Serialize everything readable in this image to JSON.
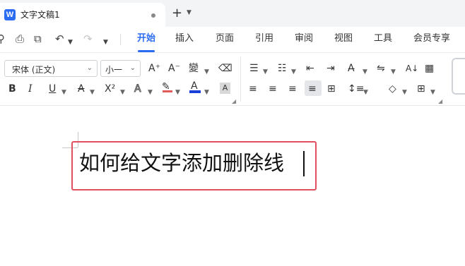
{
  "tabbar": {
    "app_logo": "W",
    "doc_title": "文字文稿1",
    "new_tab": "+",
    "arrow": "⌄"
  },
  "menubar": {
    "quick_access": {
      "save": "⌕",
      "print": "⎙",
      "preview": "⌕",
      "undo": "↶",
      "undo_arrow": "⌄",
      "redo": "↷",
      "more": "⌄"
    },
    "tabs": [
      "开始",
      "插入",
      "页面",
      "引用",
      "审阅",
      "视图",
      "工具",
      "会员专享"
    ],
    "active_tab": "开始"
  },
  "ribbon": {
    "font_name": "宋体 (正文)",
    "font_size": "小一",
    "buttons": {
      "grow_font": "A⁺",
      "shrink_font": "A⁻",
      "phonetic": "變",
      "clear_format": "⌫",
      "bold": "B",
      "italic": "I",
      "underline": "U",
      "strikethrough": "Ꝋ",
      "superscript": "X²",
      "text_effect": "A",
      "highlight": "ℤ",
      "font_color": "A",
      "char_shading": "A",
      "bullets": "⁝≡",
      "numbering": "⒈≡",
      "decrease_indent": "⇤",
      "increase_indent": "⇥",
      "text_direction": "A͡",
      "line_break": "⇋",
      "sort": "A↓",
      "table_border": "▦",
      "align_left": "≡",
      "align_center": "≡",
      "align_right": "≡",
      "justify": "≡",
      "distribute": "⊞",
      "line_spacing": "↕≡",
      "shading": "◇",
      "borders": "⊞",
      "caret": "▾",
      "launcher": "◢"
    }
  },
  "document": {
    "content": "如何给文字添加删除线"
  },
  "colors": {
    "accent": "#2b6cf0",
    "highlight_border": "#e0505e",
    "font_color_bar": "#1a3fd6"
  }
}
